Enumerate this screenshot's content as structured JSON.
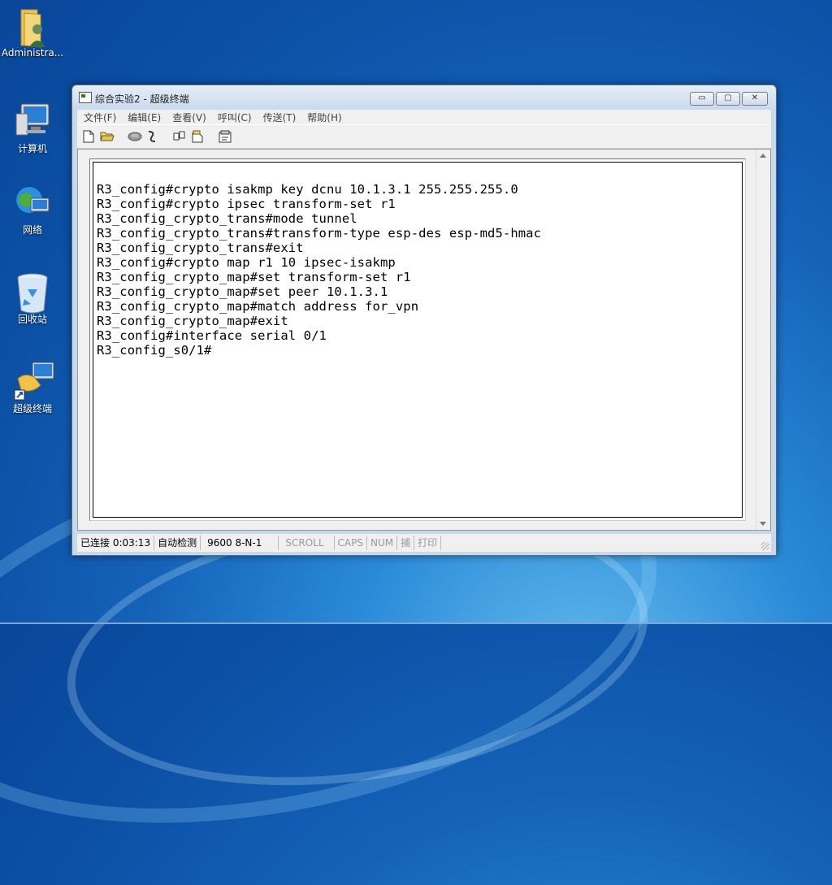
{
  "desktop": {
    "icons": [
      {
        "label": "Administra..."
      },
      {
        "label": "计算机"
      },
      {
        "label": "网络"
      },
      {
        "label": "回收站"
      },
      {
        "label": "超级终端"
      }
    ]
  },
  "window": {
    "title": "综合实验2 - 超级终端",
    "controls": {
      "minimize": "▭",
      "maximize": "▢",
      "close": "✕"
    },
    "menu": [
      "文件(F)",
      "编辑(E)",
      "查看(V)",
      "呼叫(C)",
      "传送(T)",
      "帮助(H)"
    ],
    "toolbar_icons": [
      "new-file-icon",
      "open-folder-icon",
      "phone-icon",
      "disconnect-icon",
      "send-file-icon",
      "receive-file-icon",
      "properties-icon"
    ],
    "terminal_lines": [
      "",
      "R3_config#crypto isakmp key dcnu 10.1.3.1 255.255.255.0",
      "R3_config#crypto ipsec transform-set r1",
      "R3_config_crypto_trans#mode tunnel",
      "R3_config_crypto_trans#transform-type esp-des esp-md5-hmac",
      "R3_config_crypto_trans#exit",
      "R3_config#crypto map r1 10 ipsec-isakmp",
      "R3_config_crypto_map#set transform-set r1",
      "R3_config_crypto_map#set peer 10.1.3.1",
      "R3_config_crypto_map#match address for_vpn",
      "R3_config_crypto_map#exit",
      "R3_config#interface serial 0/1",
      "R3_config_s0/1#"
    ],
    "status": {
      "connected": "已连接 0:03:13",
      "detect": "自动检测",
      "params": "9600 8-N-1",
      "scroll": "SCROLL",
      "caps": "CAPS",
      "num": "NUM",
      "capture": "捕",
      "print": "打印"
    }
  },
  "colors": {
    "desktop_blue": "#1462b8",
    "window_frame": "#c8d9ec"
  }
}
